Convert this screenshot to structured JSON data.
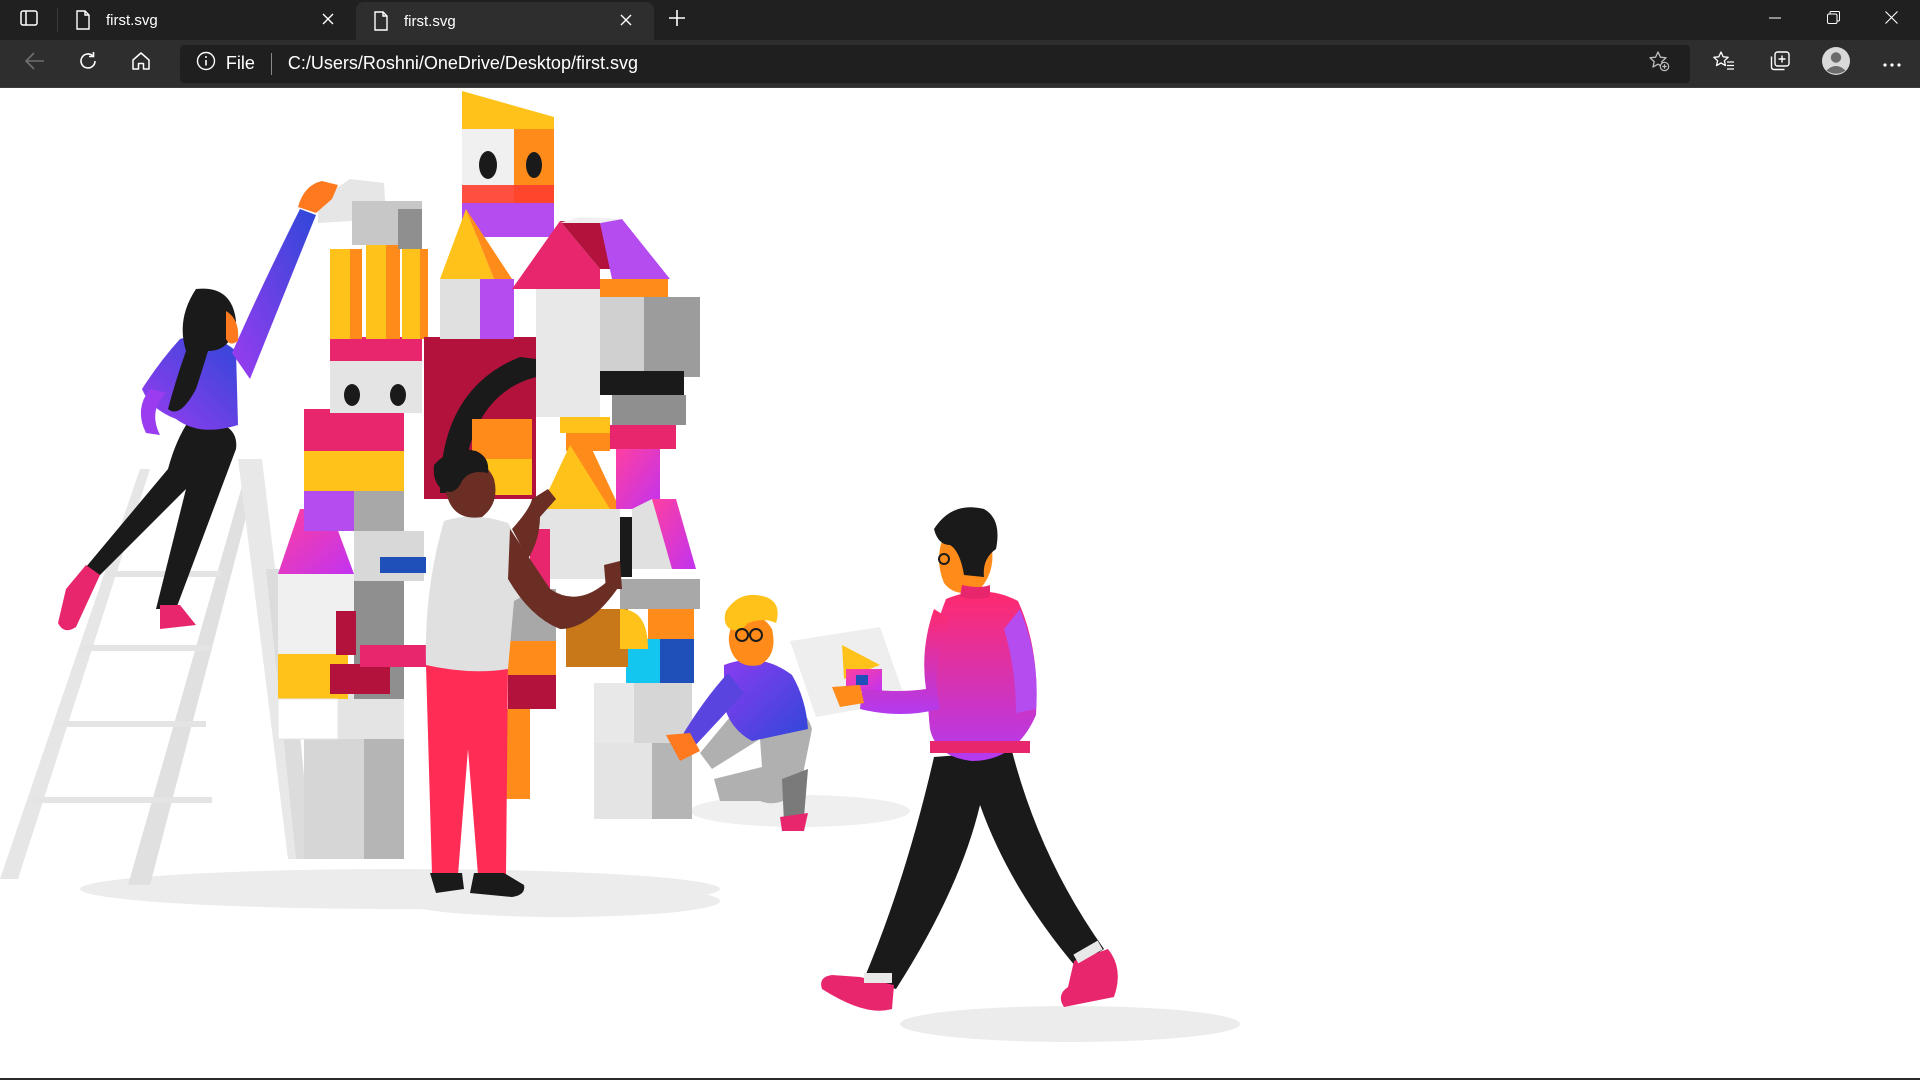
{
  "tabs": [
    {
      "title": "first.svg",
      "active": false
    },
    {
      "title": "first.svg",
      "active": true
    }
  ],
  "address_bar": {
    "scheme_label": "File",
    "url": "C:/Users/Roshni/OneDrive/Desktop/first.svg"
  },
  "icons": {
    "tab_actions": "tab-actions-icon",
    "document": "document-icon",
    "close": "close-icon",
    "new_tab": "plus-icon",
    "minimize": "minimize-icon",
    "restore": "restore-icon",
    "close_window": "close-icon",
    "back": "back-arrow-icon",
    "refresh": "refresh-icon",
    "home": "home-icon",
    "info": "info-icon",
    "add_favorite": "star-add-icon",
    "favorites": "favorites-icon",
    "collections": "collections-icon",
    "profile": "profile-avatar-icon",
    "more": "more-icon"
  },
  "colors": {
    "chrome_dark": "#202020",
    "toolbar": "#2e2e2e",
    "omnibox": "#1f1f1f",
    "magenta": "#e8266d",
    "purple": "#a93cf0",
    "orange": "#ff8c1a",
    "yellow": "#ffc21a",
    "crimson": "#b3123c",
    "cyan": "#12c6f0",
    "blue": "#1f4fb8"
  }
}
